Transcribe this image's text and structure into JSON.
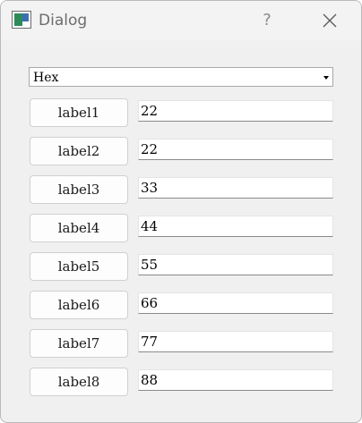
{
  "window": {
    "title": "Dialog",
    "help_glyph": "?",
    "close_icon": "close-icon"
  },
  "combo": {
    "selected": "Hex"
  },
  "rows": [
    {
      "label": "label1",
      "value": "22"
    },
    {
      "label": "label2",
      "value": "22"
    },
    {
      "label": "label3",
      "value": "33"
    },
    {
      "label": "label4",
      "value": "44"
    },
    {
      "label": "label5",
      "value": "55"
    },
    {
      "label": "label6",
      "value": "66"
    },
    {
      "label": "label7",
      "value": "77"
    },
    {
      "label": "label8",
      "value": "88"
    }
  ],
  "colors": {
    "window_bg": "#f0f0f0",
    "titlebar_bg": "#f3f3f3",
    "title_text": "#6c6c6c"
  }
}
